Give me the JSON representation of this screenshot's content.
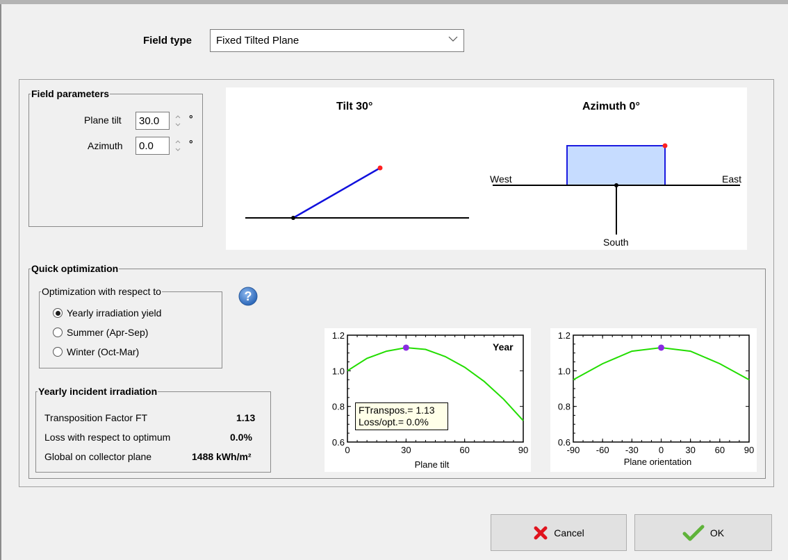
{
  "field_type": {
    "label": "Field type",
    "value": "Fixed Tilted Plane"
  },
  "field_parameters": {
    "title": "Field parameters",
    "plane_tilt": {
      "label": "Plane tilt",
      "value": "30.0",
      "unit": "°"
    },
    "azimuth": {
      "label": "Azimuth",
      "value": "0.0",
      "unit": "°"
    }
  },
  "tilt_diagram": {
    "title": "Tilt 30°"
  },
  "azimuth_diagram": {
    "title": "Azimuth 0°",
    "west": "West",
    "east": "East",
    "south": "South"
  },
  "quick_optimization": {
    "title": "Quick optimization",
    "optimize_with_respect_to": "Optimization with respect to",
    "options": [
      {
        "label": "Yearly irradiation yield",
        "selected": true
      },
      {
        "label": "Summer (Apr-Sep)",
        "selected": false
      },
      {
        "label": "Winter (Oct-Mar)",
        "selected": false
      }
    ],
    "help_icon": "help-icon"
  },
  "yearly_irradiation": {
    "title": "Yearly incident irradiation",
    "rows": [
      {
        "label": "Transposition Factor FT",
        "value": "1.13"
      },
      {
        "label": "Loss with respect to optimum",
        "value": "0.0%"
      },
      {
        "label": "Global on collector plane",
        "value": "1488 kWh/m²"
      }
    ]
  },
  "chart_data": [
    {
      "type": "line",
      "title": "Year",
      "xlabel": "Plane tilt",
      "ylabel": "",
      "xlim": [
        0,
        90
      ],
      "ylim": [
        0.6,
        1.2
      ],
      "xticks": [
        "0",
        "30",
        "60",
        "90"
      ],
      "yticks": [
        "0.6",
        "0.8",
        "1.0",
        "1.2"
      ],
      "series": [
        {
          "x": [
            0,
            10,
            20,
            30,
            40,
            50,
            60,
            70,
            80,
            90
          ],
          "y": [
            1.0,
            1.07,
            1.11,
            1.13,
            1.12,
            1.08,
            1.02,
            0.94,
            0.84,
            0.72
          ]
        }
      ],
      "marker": {
        "x": 30,
        "y": 1.13
      },
      "annotation": [
        "FTranspos.= 1.13",
        "Loss/opt.= 0.0%"
      ],
      "line_color": "#22dd00",
      "marker_color": "#8a2be2"
    },
    {
      "type": "line",
      "xlabel": "Plane orientation",
      "ylabel": "",
      "xlim": [
        -90,
        90
      ],
      "ylim": [
        0.6,
        1.2
      ],
      "xticks": [
        "-90",
        "-60",
        "-30",
        "0",
        "30",
        "60",
        "90"
      ],
      "yticks": [
        "0.6",
        "0.8",
        "1.0",
        "1.2"
      ],
      "series": [
        {
          "x": [
            -90,
            -60,
            -30,
            0,
            30,
            60,
            90
          ],
          "y": [
            0.95,
            1.04,
            1.11,
            1.13,
            1.11,
            1.04,
            0.95
          ]
        }
      ],
      "marker": {
        "x": 0,
        "y": 1.13
      },
      "line_color": "#22dd00",
      "marker_color": "#8a2be2"
    }
  ],
  "buttons": {
    "cancel": "Cancel",
    "ok": "OK"
  }
}
